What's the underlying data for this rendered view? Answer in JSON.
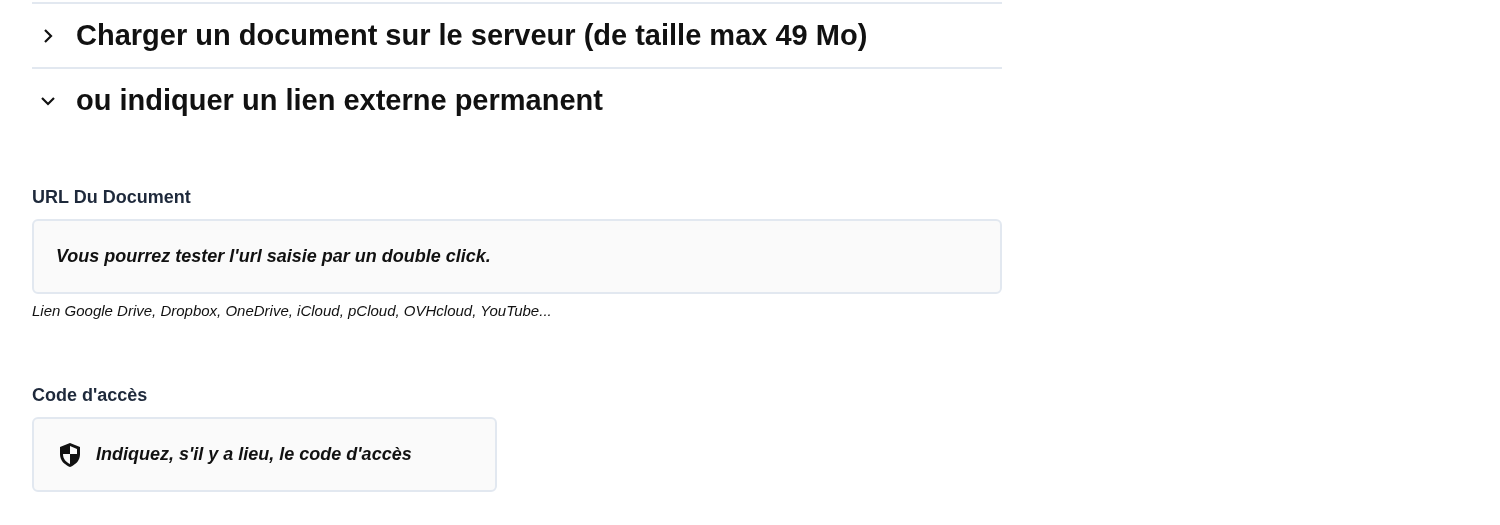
{
  "sections": [
    {
      "title": "Charger un document sur le serveur (de taille max 49 Mo)",
      "expanded": false
    },
    {
      "title": "ou indiquer un lien externe permanent",
      "expanded": true
    }
  ],
  "url_field": {
    "label": "URL Du Document",
    "placeholder": "Vous pourrez tester l'url saisie par un double click.",
    "help": "Lien Google Drive, Dropbox, OneDrive, iCloud, pCloud, OVHcloud, YouTube..."
  },
  "code_field": {
    "label": "Code d'accès",
    "placeholder": "Indiquez, s'il y a lieu, le code d'accès"
  }
}
